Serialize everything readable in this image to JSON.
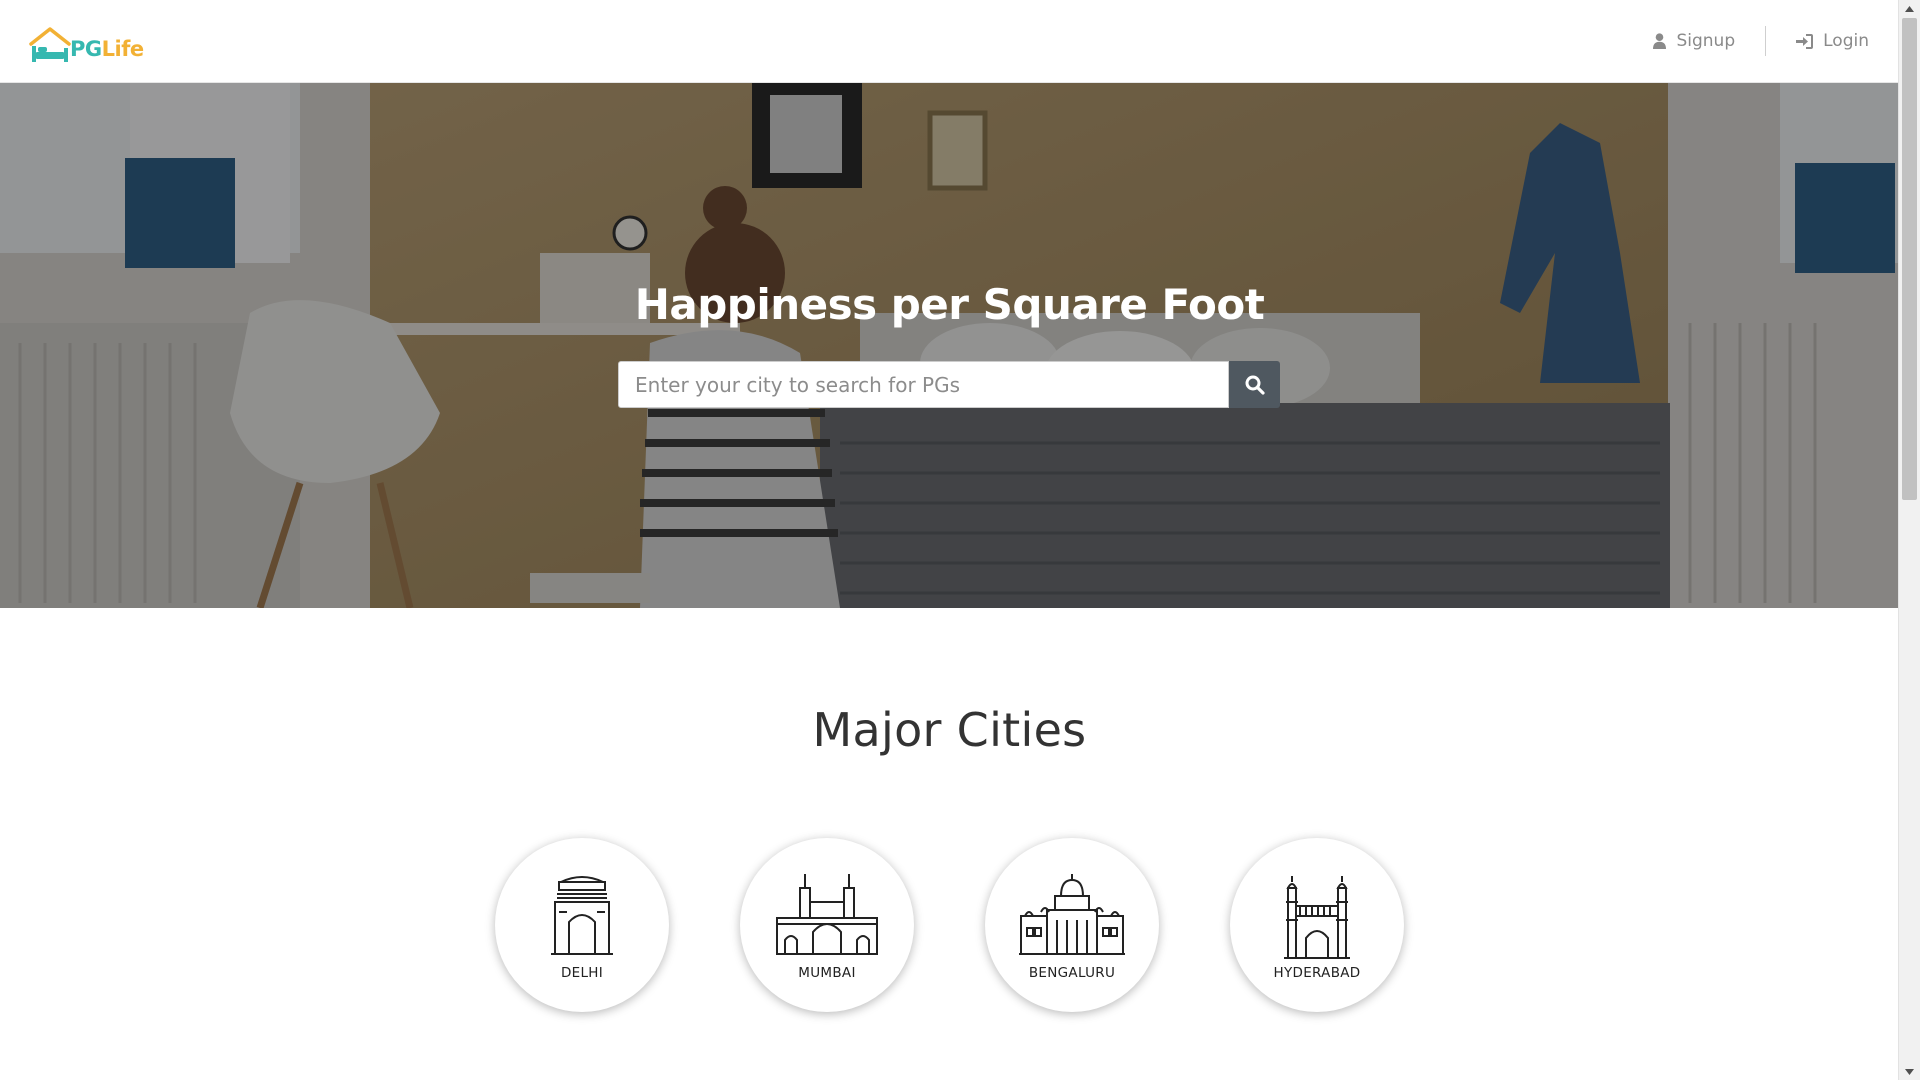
{
  "brand": {
    "name_part1": "PG",
    "name_part2": "Life",
    "color_primary": "#36b8b0",
    "color_accent": "#f2b135"
  },
  "nav": {
    "signup": {
      "label": "Signup",
      "icon": "user-icon"
    },
    "login": {
      "label": "Login",
      "icon": "sign-in-icon"
    }
  },
  "hero": {
    "title": "Happiness per Square Foot",
    "search": {
      "placeholder": "Enter your city to search for PGs",
      "value": "",
      "button_icon": "search-icon"
    }
  },
  "cities_section": {
    "title": "Major Cities",
    "cities": [
      {
        "name": "DELHI",
        "icon": "india-gate-icon"
      },
      {
        "name": "MUMBAI",
        "icon": "gateway-of-india-icon"
      },
      {
        "name": "BENGALURU",
        "icon": "vidhana-soudha-icon"
      },
      {
        "name": "HYDERABAD",
        "icon": "charminar-icon"
      }
    ]
  }
}
